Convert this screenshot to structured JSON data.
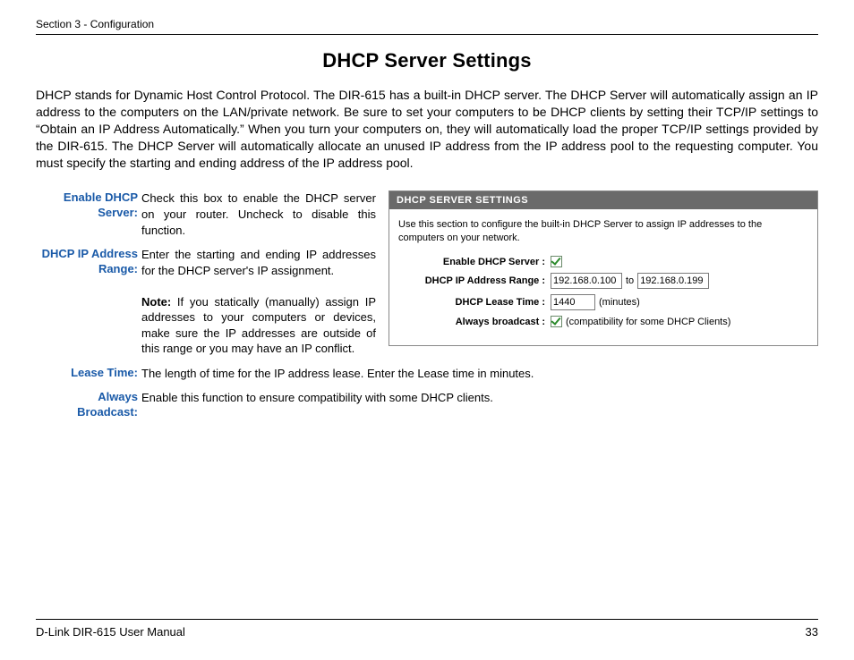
{
  "header": {
    "section": "Section 3 - Configuration"
  },
  "title": "DHCP Server Settings",
  "intro": "DHCP stands for Dynamic Host Control Protocol. The DIR-615 has a built-in DHCP server. The DHCP Server will automatically assign an IP address to the computers on the LAN/private network. Be sure to set your computers to be DHCP clients by setting their TCP/IP settings to “Obtain an IP Address Automatically.” When you turn your computers on, they will automatically load the proper TCP/IP settings provided by the DIR-615. The DHCP Server will automatically allocate an unused IP address from the IP address pool to the requesting computer. You must specify the starting and ending address of the IP address pool.",
  "defs": {
    "enable_label": "Enable DHCP Server:",
    "enable_desc": "Check this box to enable the DHCP server on your router. Uncheck to disable this function.",
    "range_label": "DHCP IP Address Range:",
    "range_desc": "Enter the starting and ending IP addresses for the DHCP server's IP assignment.",
    "range_note_label": "Note:",
    "range_note": " If you statically (manually) assign IP addresses to your computers or devices, make sure the IP addresses are outside of this range or you may have an IP conflict.",
    "lease_label": "Lease Time:",
    "lease_desc": "The length of time for the IP address lease. Enter the Lease time in minutes.",
    "always_label": "Always Broadcast:",
    "always_desc": "Enable this function to ensure compatibility with some DHCP clients."
  },
  "panel": {
    "title": "DHCP SERVER SETTINGS",
    "desc": "Use this section to configure the built-in DHCP Server to assign IP addresses to the computers on your network.",
    "enable_label": "Enable DHCP Server :",
    "range_label": "DHCP IP Address Range :",
    "range_start": "192.168.0.100",
    "range_to": "to",
    "range_end": "192.168.0.199",
    "lease_label": "DHCP Lease Time :",
    "lease_value": "1440",
    "lease_unit": "(minutes)",
    "always_label": "Always broadcast :",
    "always_hint": "(compatibility for some DHCP Clients)"
  },
  "footer": {
    "manual": "D-Link DIR-615 User Manual",
    "page": "33"
  }
}
